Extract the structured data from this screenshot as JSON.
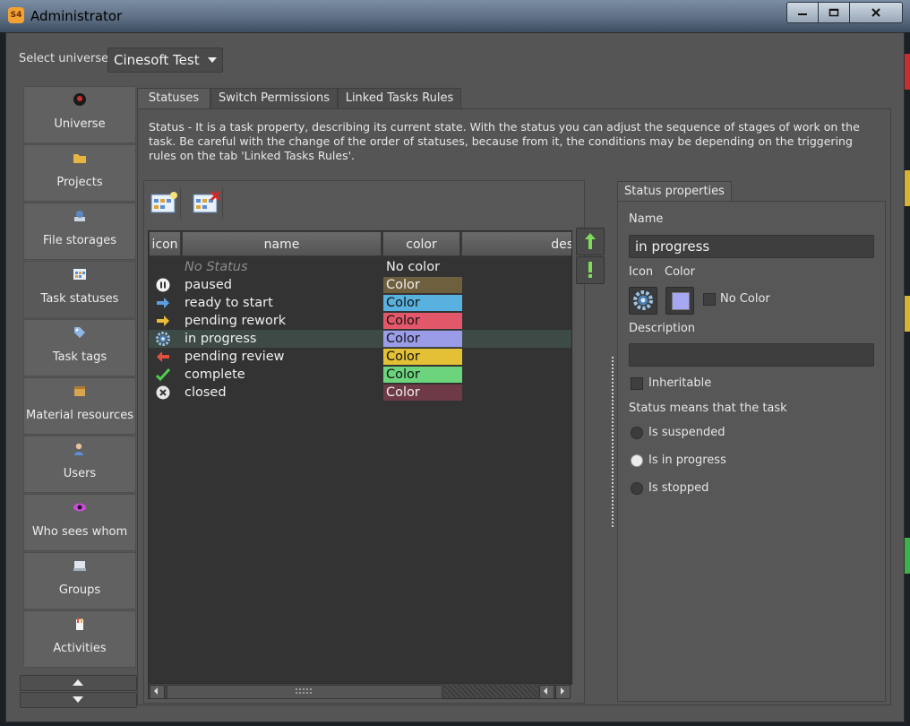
{
  "window": {
    "title": "Administrator",
    "app_icon": "S4",
    "buttons": [
      "minimize",
      "maximize",
      "close"
    ]
  },
  "universe": {
    "label": "Select universe",
    "value": "Cinesoft Test"
  },
  "sidebar": {
    "items": [
      {
        "label": "Universe",
        "icon": "universe-icon"
      },
      {
        "label": "Projects",
        "icon": "folder-icon"
      },
      {
        "label": "File storages",
        "icon": "storage-icon"
      },
      {
        "label": "Task statuses",
        "icon": "statuses-icon",
        "active": true
      },
      {
        "label": "Task tags",
        "icon": "tag-icon"
      },
      {
        "label": "Material resources",
        "icon": "box-icon"
      },
      {
        "label": "Users",
        "icon": "user-icon"
      },
      {
        "label": "Who sees whom",
        "icon": "eye-icon"
      },
      {
        "label": "Groups",
        "icon": "groups-icon"
      },
      {
        "label": "Activities",
        "icon": "activities-icon"
      }
    ]
  },
  "tabs": [
    {
      "label": "Statuses",
      "active": true
    },
    {
      "label": "Switch Permissions"
    },
    {
      "label": "Linked Tasks Rules"
    }
  ],
  "description": "Status - It is a task property, describing its current state. With the status you can adjust the sequence of stages of work on the task. Be careful with the change of the order of statuses, because from it, the conditions may be depending on the triggering rules on the tab 'Linked Tasks Rules'.",
  "table": {
    "headers": [
      "icon",
      "name",
      "color",
      "des"
    ],
    "rows": [
      {
        "name": "No Status",
        "color_label": "No color",
        "color": "",
        "icon": ""
      },
      {
        "name": "paused",
        "color_label": "Color",
        "color": "#6e5f3e",
        "icon": "pause-icon"
      },
      {
        "name": "ready to start",
        "color_label": "Color",
        "color": "#58b1de",
        "icon": "arrow-right-blue-icon"
      },
      {
        "name": "pending rework",
        "color_label": "Color",
        "color": "#e2586a",
        "icon": "arrow-right-yellow-icon"
      },
      {
        "name": "in progress",
        "color_label": "Color",
        "color": "#9b9ce8",
        "icon": "gear-icon",
        "selected": true
      },
      {
        "name": "pending review",
        "color_label": "Color",
        "color": "#e3c035",
        "icon": "arrow-left-red-icon"
      },
      {
        "name": "complete",
        "color_label": "Color",
        "color": "#6bd47c",
        "icon": "checkmark-icon"
      },
      {
        "name": "closed",
        "color_label": "Color",
        "color": "#6e3a46",
        "icon": "close-circle-icon"
      }
    ]
  },
  "properties": {
    "tab": "Status properties",
    "name_label": "Name",
    "name_value": "in progress",
    "icon_label": "Icon",
    "color_label": "Color",
    "swatch_color": "#a7a8f4",
    "no_color_label": "No Color",
    "description_label": "Description",
    "description_value": "",
    "inheritable_label": "Inheritable",
    "means_label": "Status means that the task",
    "options": [
      {
        "label": "Is suspended",
        "checked": false
      },
      {
        "label": "Is in progress",
        "checked": true
      },
      {
        "label": "Is stopped",
        "checked": false
      }
    ]
  }
}
